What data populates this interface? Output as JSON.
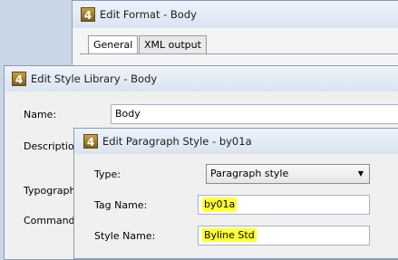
{
  "edit_format": {
    "icon_glyph": "4",
    "title": "Edit Format - Body",
    "tabs": [
      {
        "label": "General",
        "active": true
      },
      {
        "label": "XML output",
        "active": false
      }
    ]
  },
  "style_library": {
    "icon_glyph": "4",
    "title": "Edit Style Library - Body",
    "name_label": "Name:",
    "name_value": "Body",
    "description_label": "Descriptio",
    "typography_label": "Typograph",
    "command_label": "Command"
  },
  "paragraph_style": {
    "icon_glyph": "4",
    "title": "Edit Paragraph Style - by01a",
    "type_label": "Type:",
    "type_value": "Paragraph style",
    "tag_name_label": "Tag Name:",
    "tag_name_value": "by01a",
    "style_name_label": "Style Name:",
    "style_name_value": "Byline Std"
  },
  "colors": {
    "highlight": "#ffff33",
    "titlebar": "#e3ebf6",
    "desktop": "#c9d6e6"
  }
}
